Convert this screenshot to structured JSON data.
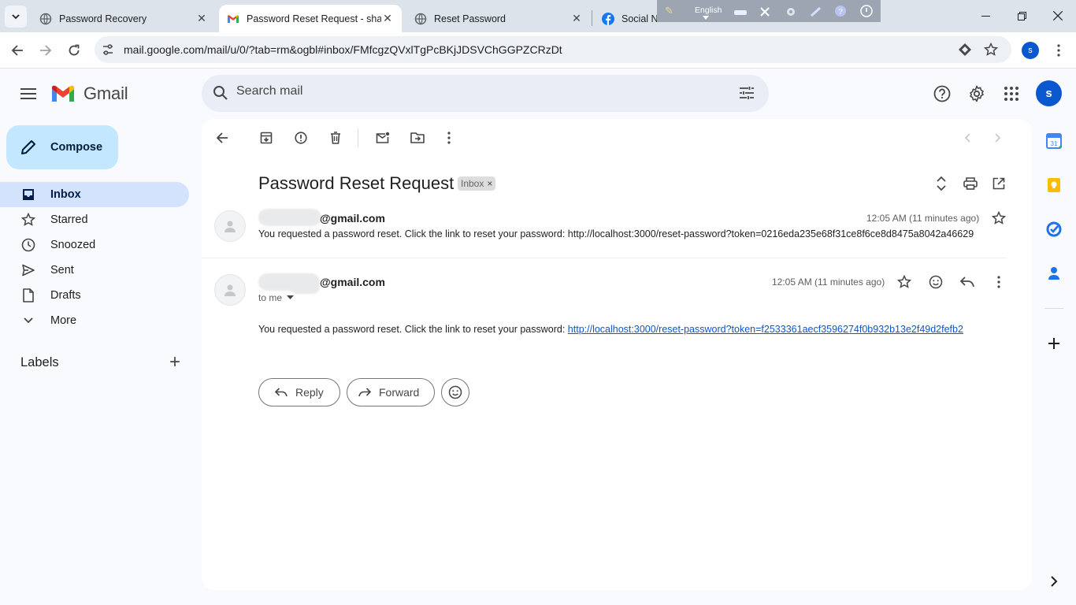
{
  "browser": {
    "tabs": [
      {
        "title": "Password Recovery",
        "favicon": "globe-icon",
        "close": "✕"
      },
      {
        "title": "Password Reset Request - shaik",
        "favicon": "gmail-icon",
        "close": "✕"
      },
      {
        "title": "Reset Password",
        "favicon": "globe-icon",
        "close": "✕"
      },
      {
        "title": "Social Network",
        "favicon": "facebook-icon"
      }
    ],
    "language_bar": {
      "label": "English"
    },
    "url": "mail.google.com/mail/u/0/?tab=rm&ogbl#inbox/FMfcgzQVxlTgPcBKjJDSVChGGPZCRzDt",
    "profile_initial": "s"
  },
  "gmail": {
    "product_name": "Gmail",
    "search_placeholder": "Search mail",
    "account_initial": "s",
    "compose_label": "Compose",
    "nav": [
      {
        "label": "Inbox",
        "icon": "inbox-icon",
        "active": true
      },
      {
        "label": "Starred",
        "icon": "star-icon"
      },
      {
        "label": "Snoozed",
        "icon": "clock-icon"
      },
      {
        "label": "Sent",
        "icon": "send-icon"
      },
      {
        "label": "Drafts",
        "icon": "draft-icon"
      },
      {
        "label": "More",
        "icon": "chevron-down-icon"
      }
    ],
    "labels_heading": "Labels",
    "add_label": "+"
  },
  "thread": {
    "subject": "Password Reset Request",
    "chip": "Inbox",
    "chip_close": "×",
    "messages": [
      {
        "sender_visible": "@gmail.com",
        "time": "12:05 AM (11 minutes ago)",
        "snippet": "You requested a password reset. Click the link to reset your password: http://localhost:3000/reset-password?token=0216eda235e68f31ce8f6ce8d8475a8042a46629"
      },
      {
        "sender_visible": "@gmail.com",
        "time": "12:05 AM (11 minutes ago)",
        "to_line": "to me",
        "body_text": "You requested a password reset. Click the link to reset your password: ",
        "body_link": "http://localhost:3000/reset-password?token=f2533361aecf3596274f0b932b13e2f49d2fefb2"
      }
    ],
    "reply_label": "Reply",
    "forward_label": "Forward"
  },
  "colors": {
    "accent_blue": "#0b57d0",
    "compose_bg": "#c2e7ff",
    "active_nav_bg": "#d3e3fd",
    "avatar_bg": "#0b57d0"
  }
}
